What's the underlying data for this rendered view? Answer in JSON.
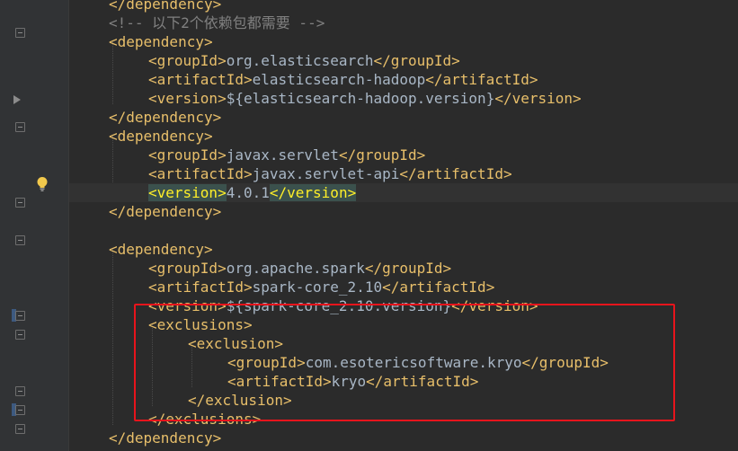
{
  "code": {
    "lines": [
      {
        "parts": [
          {
            "t": "</dependency>",
            "c": "tag"
          }
        ]
      },
      {
        "parts": [
          {
            "t": "<!-- 以下2个依赖包都需要 -->",
            "c": "comment"
          }
        ]
      },
      {
        "parts": [
          {
            "t": "<dependency>",
            "c": "tag"
          }
        ]
      },
      {
        "parts": [
          {
            "t": "<groupId>",
            "c": "tag"
          },
          {
            "t": "org.elasticsearch",
            "c": "text"
          },
          {
            "t": "</groupId>",
            "c": "tag"
          }
        ]
      },
      {
        "parts": [
          {
            "t": "<artifactId>",
            "c": "tag"
          },
          {
            "t": "elasticsearch-hadoop",
            "c": "text"
          },
          {
            "t": "</artifactId>",
            "c": "tag"
          }
        ]
      },
      {
        "parts": [
          {
            "t": "<version>",
            "c": "tag"
          },
          {
            "t": "${elasticsearch-hadoop.version}",
            "c": "text"
          },
          {
            "t": "</version>",
            "c": "tag"
          }
        ]
      },
      {
        "parts": [
          {
            "t": "</dependency>",
            "c": "tag"
          }
        ]
      },
      {
        "parts": [
          {
            "t": "<dependency>",
            "c": "tag"
          }
        ]
      },
      {
        "parts": [
          {
            "t": "<groupId>",
            "c": "tag"
          },
          {
            "t": "javax.servlet",
            "c": "text"
          },
          {
            "t": "</groupId>",
            "c": "tag"
          }
        ]
      },
      {
        "parts": [
          {
            "t": "<artifactId>",
            "c": "tag"
          },
          {
            "t": "javax.servlet-api",
            "c": "text"
          },
          {
            "t": "</artifactId>",
            "c": "tag"
          }
        ]
      },
      {
        "parts": [
          {
            "t": "<version>",
            "c": "hl"
          },
          {
            "t": "4.0.1",
            "c": "text"
          },
          {
            "t": "</version>",
            "c": "hl"
          }
        ]
      },
      {
        "parts": [
          {
            "t": "</dependency>",
            "c": "tag"
          }
        ]
      },
      {
        "parts": []
      },
      {
        "parts": [
          {
            "t": "<dependency>",
            "c": "tag"
          }
        ]
      },
      {
        "parts": [
          {
            "t": "<groupId>",
            "c": "tag"
          },
          {
            "t": "org.apache.spark",
            "c": "text"
          },
          {
            "t": "</groupId>",
            "c": "tag"
          }
        ]
      },
      {
        "parts": [
          {
            "t": "<artifactId>",
            "c": "tag"
          },
          {
            "t": "spark-core_2.10",
            "c": "text"
          },
          {
            "t": "</artifactId>",
            "c": "tag"
          }
        ]
      },
      {
        "parts": [
          {
            "t": "<version>",
            "c": "tag"
          },
          {
            "t": "${spark-core_2.10.version}",
            "c": "text"
          },
          {
            "t": "</version>",
            "c": "tag"
          }
        ]
      },
      {
        "parts": [
          {
            "t": "<exclusions>",
            "c": "tag"
          }
        ]
      },
      {
        "parts": [
          {
            "t": "<exclusion>",
            "c": "tag"
          }
        ]
      },
      {
        "parts": [
          {
            "t": "<groupId>",
            "c": "tag"
          },
          {
            "t": "com.esotericsoftware.kryo",
            "c": "text"
          },
          {
            "t": "</groupId>",
            "c": "tag"
          }
        ]
      },
      {
        "parts": [
          {
            "t": "<artifactId>",
            "c": "tag"
          },
          {
            "t": "kryo",
            "c": "text"
          },
          {
            "t": "</artifactId>",
            "c": "tag"
          }
        ]
      },
      {
        "parts": [
          {
            "t": "</exclusion>",
            "c": "tag"
          }
        ]
      },
      {
        "parts": [
          {
            "t": "</exclusions>",
            "c": "tag"
          }
        ]
      },
      {
        "parts": [
          {
            "t": "</dependency>",
            "c": "tag"
          }
        ]
      }
    ]
  },
  "colors": {
    "background": "#2b2b2b",
    "gutter": "#313335",
    "tag": "#e8bf6a",
    "text": "#a9b7c6",
    "comment": "#808080",
    "tag_match_highlight": "#3b514d",
    "annotation_box": "#e8141c"
  },
  "gutter_icons": {
    "intention": "lightbulb-icon",
    "fold": "fold-minus-icon",
    "collapsed": "fold-arrow-icon"
  }
}
